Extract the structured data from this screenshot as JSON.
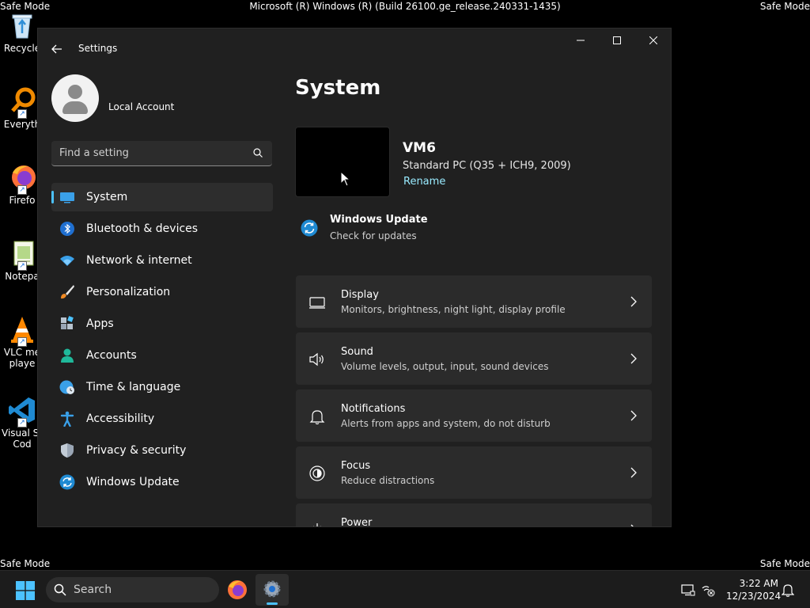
{
  "system_overlay": {
    "safe_mode": "Safe Mode",
    "build": "Microsoft (R) Windows (R) (Build 26100.ge_release.240331-1435)"
  },
  "desktop": {
    "icons": [
      {
        "label": "Recycle",
        "icon": "recycle-bin-icon"
      },
      {
        "label": "Everyth",
        "icon": "everything-search-icon"
      },
      {
        "label": "Firefo",
        "icon": "firefox-icon"
      },
      {
        "label": "Notepa",
        "icon": "notepad-icon"
      },
      {
        "label": "VLC me\nplaye",
        "icon": "vlc-icon"
      },
      {
        "label": "Visual St\nCod",
        "icon": "vscode-icon"
      }
    ]
  },
  "window": {
    "title": "Settings",
    "back_icon": "back-arrow-icon",
    "minimize_glyph": "—",
    "maximize_glyph": "☐",
    "close_glyph": "✕"
  },
  "account": {
    "name": "Local Account"
  },
  "search": {
    "placeholder": "Find a setting"
  },
  "nav": {
    "items": [
      {
        "label": "System",
        "icon": "system-display-icon",
        "active": true
      },
      {
        "label": "Bluetooth & devices",
        "icon": "bluetooth-icon"
      },
      {
        "label": "Network & internet",
        "icon": "wifi-icon"
      },
      {
        "label": "Personalization",
        "icon": "brush-icon"
      },
      {
        "label": "Apps",
        "icon": "apps-icon"
      },
      {
        "label": "Accounts",
        "icon": "accounts-icon"
      },
      {
        "label": "Time & language",
        "icon": "globe-clock-icon"
      },
      {
        "label": "Accessibility",
        "icon": "accessibility-icon"
      },
      {
        "label": "Privacy & security",
        "icon": "shield-icon"
      },
      {
        "label": "Windows Update",
        "icon": "update-icon"
      }
    ]
  },
  "content": {
    "title": "System",
    "device": {
      "name": "VM6",
      "model": "Standard PC (Q35 + ICH9, 2009)",
      "rename": "Rename"
    },
    "windows_update": {
      "title": "Windows Update",
      "subtitle": "Check for updates"
    },
    "cards": [
      {
        "title": "Display",
        "subtitle": "Monitors, brightness, night light, display profile",
        "icon": "monitor-icon"
      },
      {
        "title": "Sound",
        "subtitle": "Volume levels, output, input, sound devices",
        "icon": "speaker-icon"
      },
      {
        "title": "Notifications",
        "subtitle": "Alerts from apps and system, do not disturb",
        "icon": "bell-icon"
      },
      {
        "title": "Focus",
        "subtitle": "Reduce distractions",
        "icon": "focus-icon"
      },
      {
        "title": "Power",
        "subtitle": "",
        "icon": "power-icon"
      }
    ]
  },
  "taskbar": {
    "search_label": "Search",
    "time": "3:22 AM",
    "date": "12/23/2024"
  },
  "colors": {
    "accent": "#4cc2ff",
    "link": "#99ebff",
    "window_bg": "#202020",
    "card_bg": "#2b2b2b"
  }
}
